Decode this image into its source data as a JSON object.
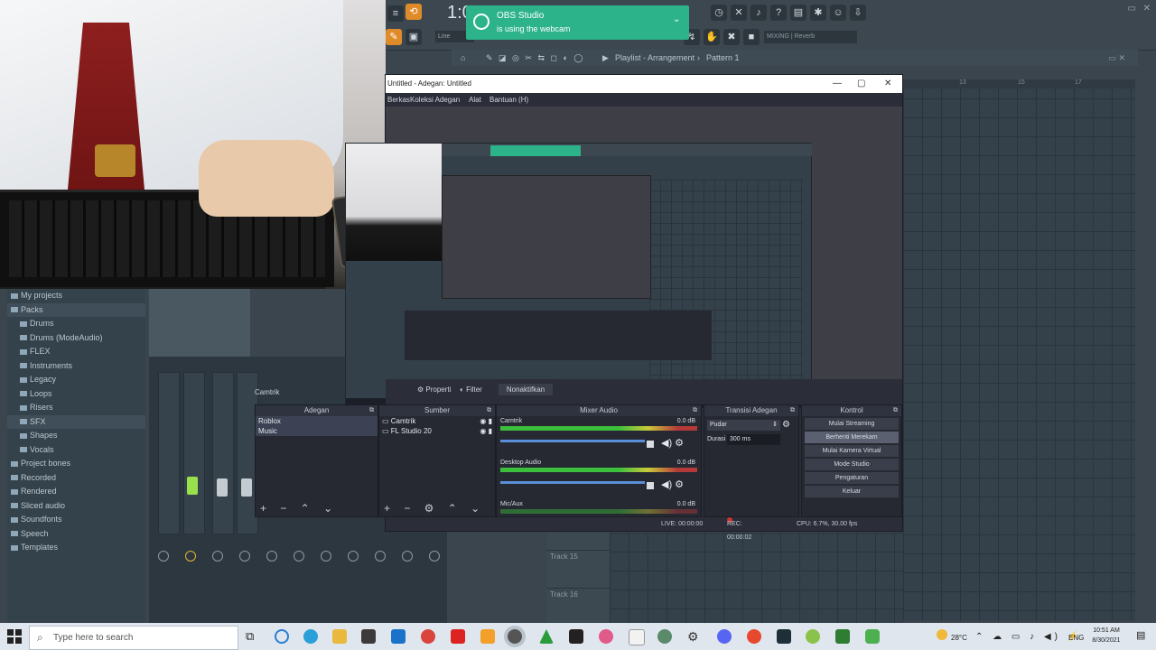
{
  "fl": {
    "time": "1:0",
    "mixer_preset": "MIXING | Reverb",
    "playlist_title": "Playlist - Arrangement",
    "pattern": "Pattern 1",
    "ruler": [
      "13",
      "15",
      "17"
    ],
    "tracks": [
      "Track 15",
      "Track 16"
    ],
    "line_mode": "Line"
  },
  "toast": {
    "title": "OBS Studio",
    "message": "is using the webcam"
  },
  "browser": {
    "items": [
      {
        "label": "My projects",
        "level": 0
      },
      {
        "label": "Packs",
        "level": 0,
        "selected": true
      },
      {
        "label": "Drums",
        "level": 1
      },
      {
        "label": "Drums (ModeAudio)",
        "level": 1
      },
      {
        "label": "FLEX",
        "level": 1
      },
      {
        "label": "Instruments",
        "level": 1
      },
      {
        "label": "Legacy",
        "level": 1
      },
      {
        "label": "Loops",
        "level": 1
      },
      {
        "label": "Risers",
        "level": 1
      },
      {
        "label": "SFX",
        "level": 1,
        "selected": true
      },
      {
        "label": "Shapes",
        "level": 1
      },
      {
        "label": "Vocals",
        "level": 1
      },
      {
        "label": "Project bones",
        "level": 0
      },
      {
        "label": "Recorded",
        "level": 0
      },
      {
        "label": "Rendered",
        "level": 0
      },
      {
        "label": "Sliced audio",
        "level": 0
      },
      {
        "label": "Soundfonts",
        "level": 0
      },
      {
        "label": "Speech",
        "level": 0
      },
      {
        "label": "Templates",
        "level": 0
      }
    ]
  },
  "obs": {
    "title": "Untitled - Adegan: Untitled",
    "menu": [
      "Berkas",
      "Koleksi Adegan",
      "Alat",
      "Bantuan (H)"
    ],
    "selected_source": "Camtrik",
    "properties": "Properti",
    "filters": "Filter",
    "hide": "Nonaktifkan",
    "scenes_title": "Adegan",
    "scenes": [
      "Roblox",
      "Music"
    ],
    "sources_title": "Sumber",
    "sources": [
      "Camtrik",
      "FL Studio 20"
    ],
    "audio_title": "Mixer Audio",
    "audio": [
      {
        "name": "Camtrik",
        "db": "0.0 dB"
      },
      {
        "name": "Desktop Audio",
        "db": "0.0 dB"
      },
      {
        "name": "Mic/Aux",
        "db": "0.0 dB"
      }
    ],
    "transitions_title": "Transisi Adegan",
    "transition": "Pudar",
    "duration_label": "Durasi",
    "duration": "300 ms",
    "controls_title": "Kontrol",
    "controls": [
      "Mulai Streaming",
      "Berhenti Merekam",
      "Mulai Kamera Virtual",
      "Mode Studio",
      "Pengaturan",
      "Keluar"
    ],
    "status": {
      "live": "LIVE: 00:00:00",
      "rec": "REC: 00:00:02",
      "cpu": "CPU: 6.7%, 30.00 fps"
    }
  },
  "taskbar": {
    "search_placeholder": "Type here to search",
    "weather": "28°C",
    "lang": "ENG",
    "time": "10:51 AM",
    "date": "8/30/2021"
  }
}
